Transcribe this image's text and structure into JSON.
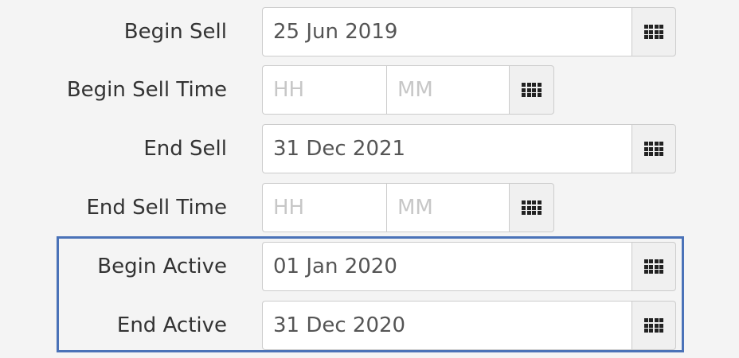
{
  "form": {
    "begin_sell": {
      "label": "Begin Sell",
      "value": "25 Jun 2019"
    },
    "begin_sell_time": {
      "label": "Begin Sell Time",
      "hours_placeholder": "HH",
      "minutes_placeholder": "MM"
    },
    "end_sell": {
      "label": "End Sell",
      "value": "31 Dec 2021"
    },
    "end_sell_time": {
      "label": "End Sell Time",
      "hours_placeholder": "HH",
      "minutes_placeholder": "MM"
    },
    "begin_active": {
      "label": "Begin Active",
      "value": "01 Jan 2020"
    },
    "end_active": {
      "label": "End Active",
      "value": "31 Dec 2020"
    }
  },
  "icons": {
    "calendar_button": "calendar-grid-icon"
  },
  "colors": {
    "highlight_border": "#4a72b8",
    "background": "#f4f4f4",
    "input_border": "#cccccc",
    "label_text": "#333333",
    "placeholder_text": "#c7c7c7"
  }
}
